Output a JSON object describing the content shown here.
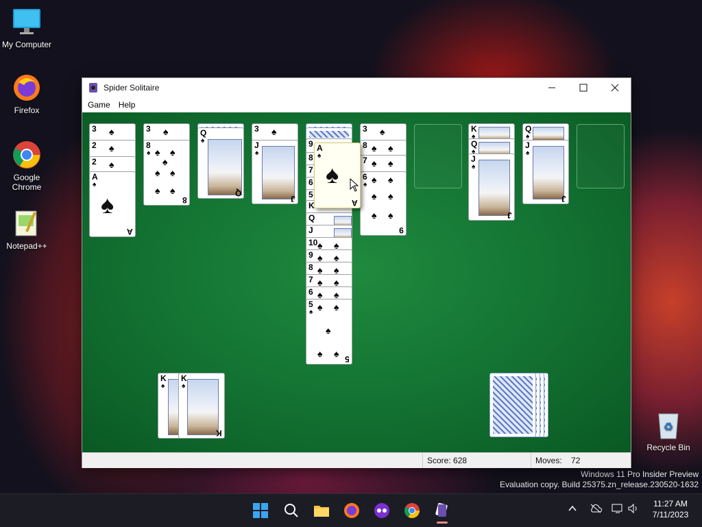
{
  "desktop": {
    "icons": [
      {
        "label": "My Computer"
      },
      {
        "label": "Firefox"
      },
      {
        "label": "Google Chrome"
      },
      {
        "label": "Notepad++"
      },
      {
        "label": "Recycle Bin"
      }
    ]
  },
  "window": {
    "title": "Spider Solitaire",
    "menu": [
      "Game",
      "Help"
    ],
    "tableau": {
      "col1": [
        "3",
        "2",
        "2",
        "A"
      ],
      "col2": [
        "3",
        "8"
      ],
      "col3": [
        "Q"
      ],
      "col4": [
        "3",
        "J"
      ],
      "col5": [
        "9",
        "8",
        "7",
        "6",
        "5",
        "K",
        "Q",
        "J",
        "10",
        "9",
        "8",
        "7",
        "6",
        "5"
      ],
      "col6": [
        "3",
        "8",
        "7",
        "6",
        "9"
      ],
      "col8": [
        "K",
        "Q",
        "J"
      ],
      "col9": [
        "Q",
        "J"
      ]
    },
    "dragging_card": "A",
    "completed_kings": [
      "K",
      "K"
    ],
    "suit": "♠",
    "status": {
      "score": "Score: 628",
      "moves_label": "Moves:",
      "moves_value": "72"
    }
  },
  "watermark": {
    "line1": "Windows 11 Pro Insider Preview",
    "line2": "Evaluation copy. Build 25375.zn_release.230520-1632"
  },
  "clock": {
    "time": "11:27 AM",
    "date": "7/11/2023"
  },
  "colors": {
    "felt": "#137232",
    "taskbar": "#1c1c25"
  }
}
